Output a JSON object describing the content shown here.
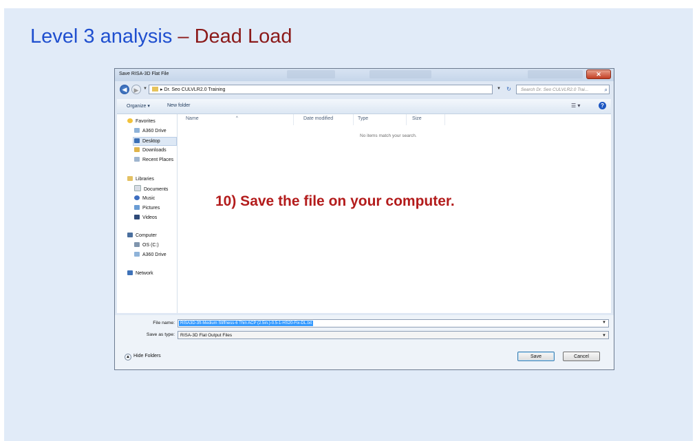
{
  "slide": {
    "title_part1": "Level 3 analysis",
    "title_sep": " – ",
    "title_part2": "Dead Load",
    "annotation": "10) Save the file on your computer."
  },
  "dialog": {
    "title": "Save RISA-3D Flat File",
    "address_path": "Dr. Seo CULVLR2.0 Training",
    "search_placeholder": "Search Dr. Seo CULVLR2.0 Trai...",
    "toolbar": {
      "organize": "Organize ▾",
      "new_folder": "New folder"
    },
    "nav": {
      "favorites": "Favorites",
      "favorite_items": [
        "A360 Drive",
        "Desktop",
        "Downloads",
        "Recent Places"
      ],
      "libraries": "Libraries",
      "library_items": [
        "Documents",
        "Music",
        "Pictures",
        "Videos"
      ],
      "computer": "Computer",
      "computer_items": [
        "OS (C:)",
        "A360 Drive"
      ],
      "network": "Network"
    },
    "columns": [
      "Name",
      "Date modified",
      "Type",
      "Size"
    ],
    "empty_message": "No items match your search.",
    "file_name_label": "File name:",
    "file_name_value": "RISA3D-3ft-Medium Stiffness-6 Thin ACP (2.5in.)-0.5-1-HS20-Fix-DL.txt",
    "save_type_label": "Save as type:",
    "save_type_value": "RISA-3D Flat Output Files",
    "hide_folders": "Hide Folders",
    "save_button": "Save",
    "cancel_button": "Cancel"
  },
  "colors": {
    "title_blue": "#1f4fcf",
    "title_red": "#8b1a1a",
    "annotation_red": "#b31c1c",
    "selection_blue": "#3399ff"
  }
}
